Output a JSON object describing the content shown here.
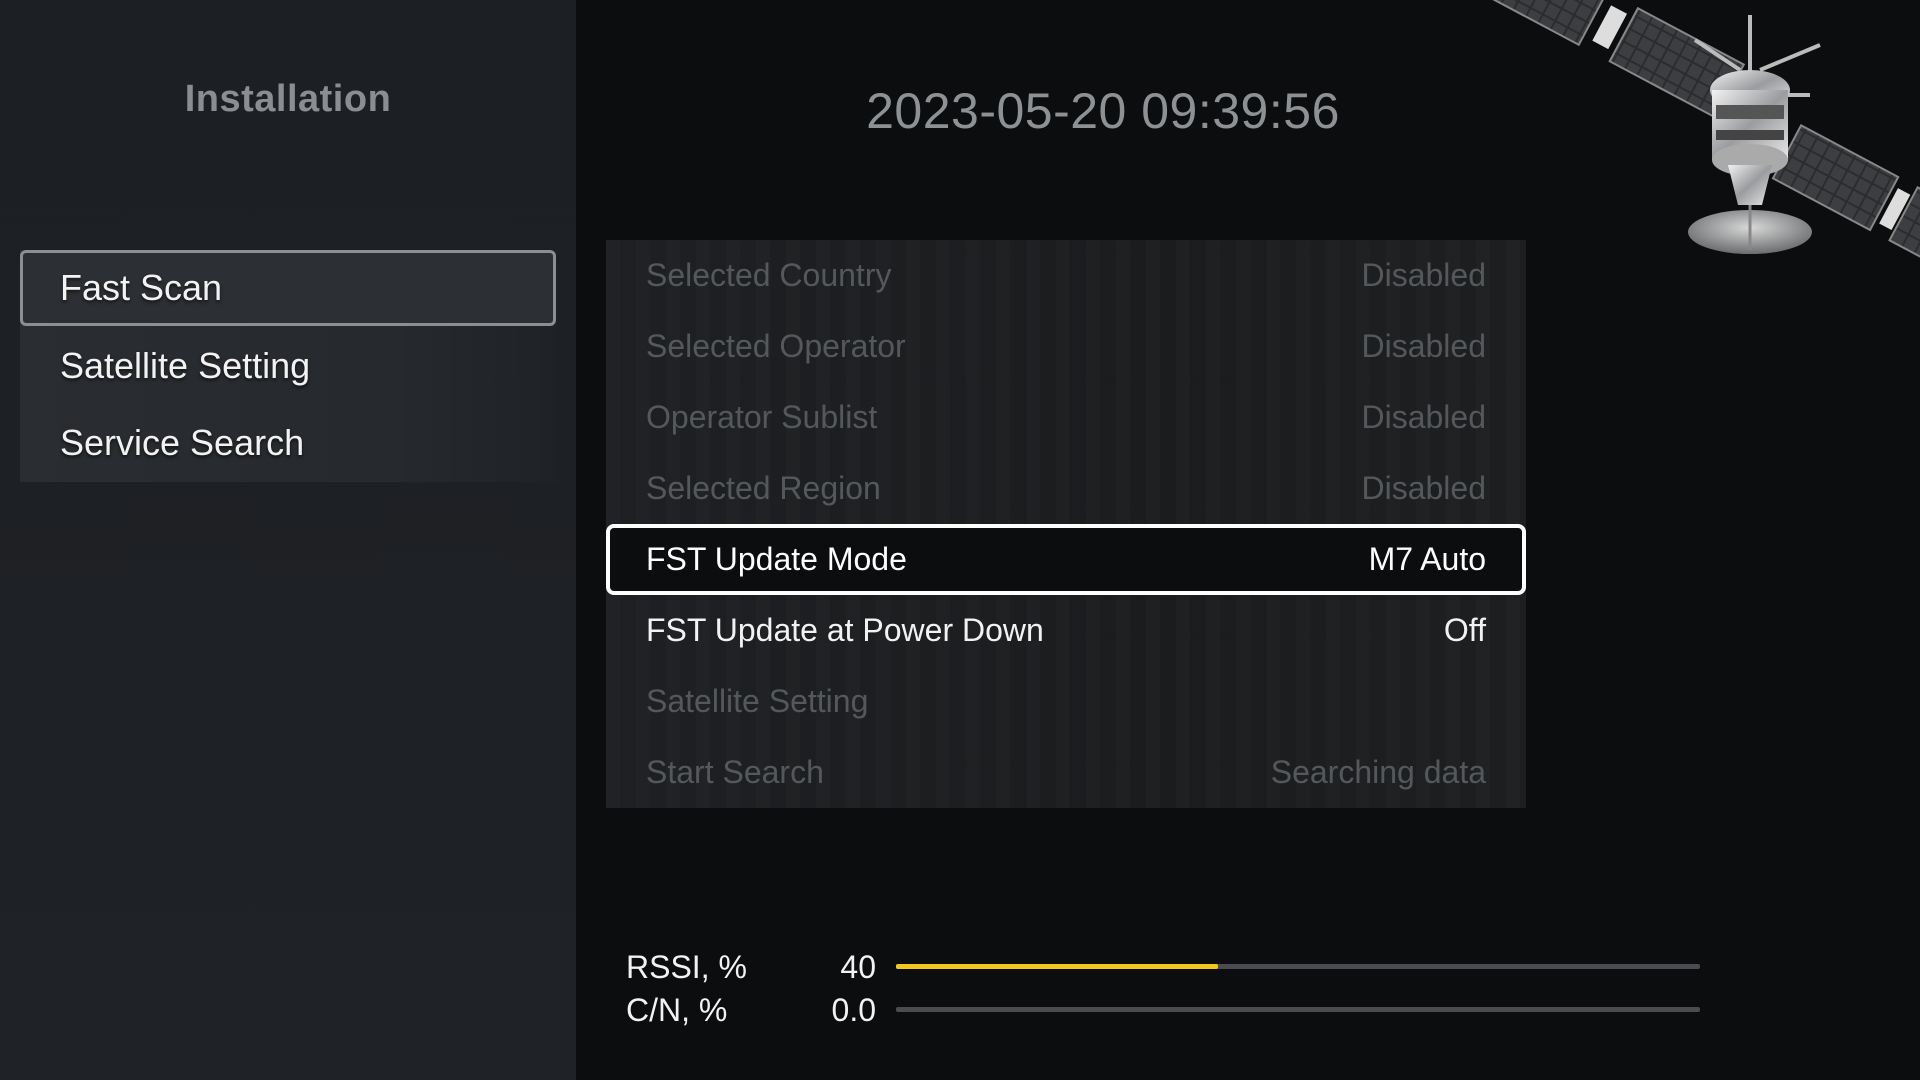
{
  "sidebar": {
    "title": "Installation",
    "items": [
      {
        "label": "Fast Scan",
        "active": true
      },
      {
        "label": "Satellite Setting",
        "active": false
      },
      {
        "label": "Service Search",
        "active": false
      }
    ]
  },
  "header": {
    "datetime": "2023-05-20 09:39:56",
    "decoration_icon": "satellite-icon"
  },
  "settings": [
    {
      "label": "Selected Country",
      "value": "Disabled",
      "state": "disabled"
    },
    {
      "label": "Selected Operator",
      "value": "Disabled",
      "state": "disabled"
    },
    {
      "label": "Operator Sublist",
      "value": "Disabled",
      "state": "disabled"
    },
    {
      "label": "Selected Region",
      "value": "Disabled",
      "state": "disabled"
    },
    {
      "label": "FST Update Mode",
      "value": "M7 Auto",
      "state": "selected"
    },
    {
      "label": "FST Update at Power Down",
      "value": "Off",
      "state": "enabled"
    },
    {
      "label": "Satellite Setting",
      "value": "",
      "state": "disabled"
    },
    {
      "label": "Start Search",
      "value": "Searching data",
      "state": "disabled"
    }
  ],
  "signal": {
    "rssi": {
      "label": "RSSI, %",
      "value": "40",
      "percent": 40,
      "color": "#f2c81e"
    },
    "cn": {
      "label": "C/N, %",
      "value": "0.0",
      "percent": 0,
      "color": "#f2c81e"
    }
  },
  "colors": {
    "accent_bar": "#f2c81e",
    "selection_border": "#ffffff",
    "disabled_text": "#55585b"
  }
}
